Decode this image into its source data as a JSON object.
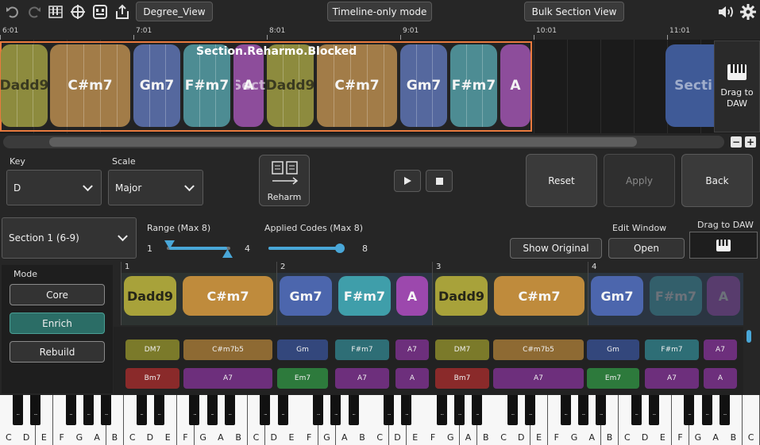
{
  "toolbar": {
    "degree_view": "Degree_View",
    "timeline_mode": "Timeline-only mode",
    "bulk_view": "Bulk Section View",
    "icons": [
      "undo-icon",
      "redo-icon",
      "score-icon",
      "crosshair-icon",
      "midi-icon",
      "export-icon",
      "speaker-icon",
      "gear-icon"
    ]
  },
  "timeline": {
    "ticks": [
      "6:01",
      "7:01",
      "8:01",
      "9:01",
      "10:01",
      "11:01"
    ],
    "section_title": "Section.Reharmo.Blocked",
    "next_section_label": "Secti",
    "chords": [
      {
        "label": "Dadd9",
        "color": "#8d8b3e"
      },
      {
        "label": "C#m7",
        "color": "#a27c48"
      },
      {
        "label": "Gm7",
        "color": "#55689e"
      },
      {
        "label": "F#m7",
        "color": "#4d8c93"
      },
      {
        "label": "A",
        "color": "#8d4d9b"
      },
      {
        "label": "Secti",
        "color": "#8d4d9b"
      },
      {
        "label": "Dadd9",
        "color": "#8d8b3e"
      },
      {
        "label": "C#m7",
        "color": "#a27c48"
      },
      {
        "label": "Gm7",
        "color": "#55689e"
      },
      {
        "label": "F#m7",
        "color": "#4d8c93"
      },
      {
        "label": "A",
        "color": "#8d4d9b"
      }
    ],
    "drag_to_daw": "Drag to DAW"
  },
  "controls": {
    "key_label": "Key",
    "key_value": "D",
    "scale_label": "Scale",
    "scale_value": "Major",
    "reharm": "Reharm",
    "reset": "Reset",
    "apply": "Apply",
    "back": "Back",
    "section_value": "Section 1 (6-9)",
    "range_label": "Range (Max 8)",
    "range_min": "1",
    "range_max": "4",
    "applied_label": "Applied Codes (Max 8)",
    "applied_value": "8",
    "applied_fraction": 1.0,
    "show_original": "Show Original",
    "edit_window_label": "Edit Window",
    "open": "Open",
    "drag_to_daw": "Drag to DAW"
  },
  "mode": {
    "label": "Mode",
    "core": "Core",
    "enrich": "Enrich",
    "rebuild": "Rebuild",
    "selected": "Enrich"
  },
  "bars": [
    "1",
    "2",
    "3",
    "4"
  ],
  "strip_chords": [
    {
      "label": "Dadd9",
      "color": "#a8a23a",
      "dim": false
    },
    {
      "label": "C#m7",
      "color": "#bf8b3c",
      "dim": false
    },
    {
      "label": "Gm7",
      "color": "#4c66ad",
      "dim": false
    },
    {
      "label": "F#m7",
      "color": "#3f9eaa",
      "dim": false
    },
    {
      "label": "A",
      "color": "#9c48ad",
      "dim": false
    },
    {
      "label": "Dadd9",
      "color": "#a8a23a",
      "dim": false
    },
    {
      "label": "C#m7",
      "color": "#bf8b3c",
      "dim": false
    },
    {
      "label": "Gm7",
      "color": "#4c66ad",
      "dim": false
    },
    {
      "label": "F#m7",
      "color": "#3f9eaa",
      "dim": true
    },
    {
      "label": "A",
      "color": "#9c48ad",
      "dim": true
    }
  ],
  "suggestions_row1": [
    {
      "label": "DM7",
      "color": "#7b7a2a"
    },
    {
      "label": "C#m7b5",
      "color": "#8e6a33"
    },
    {
      "label": "Gm",
      "color": "#33477c"
    },
    {
      "label": "F#m7",
      "color": "#2e6e76"
    },
    {
      "label": "A7",
      "color": "#6d2f7c"
    },
    {
      "label": "DM7",
      "color": "#7b7a2a"
    },
    {
      "label": "C#m7b5",
      "color": "#8e6a33"
    },
    {
      "label": "Gm",
      "color": "#33477c"
    },
    {
      "label": "F#m7",
      "color": "#2e6e76"
    },
    {
      "label": "A7",
      "color": "#6d2f7c"
    }
  ],
  "suggestions_row2": [
    {
      "label": "Bm7",
      "color": "#8a2a2a"
    },
    {
      "label": "A7",
      "color": "#6d2f7c"
    },
    {
      "label": "Em7",
      "color": "#2d7a3c"
    },
    {
      "label": "A7",
      "color": "#6d2f7c"
    },
    {
      "label": "A",
      "color": "#6d2f7c"
    },
    {
      "label": "Bm7",
      "color": "#8a2a2a"
    },
    {
      "label": "A7",
      "color": "#6d2f7c"
    },
    {
      "label": "Em7",
      "color": "#2d7a3c"
    },
    {
      "label": "A7",
      "color": "#6d2f7c"
    },
    {
      "label": "A",
      "color": "#6d2f7c"
    }
  ],
  "piano": {
    "white_keys": [
      "C",
      "D",
      "E",
      "F",
      "G",
      "A",
      "B",
      "C",
      "D",
      "E",
      "F",
      "G",
      "A",
      "B",
      "C",
      "D",
      "E",
      "F",
      "G",
      "A",
      "B",
      "C",
      "D",
      "E",
      "F",
      "G",
      "A",
      "B",
      "C",
      "D",
      "E",
      "F",
      "G",
      "A",
      "B",
      "C",
      "D",
      "E",
      "F",
      "G",
      "A",
      "B",
      "C"
    ],
    "black_key_mark": "..."
  }
}
